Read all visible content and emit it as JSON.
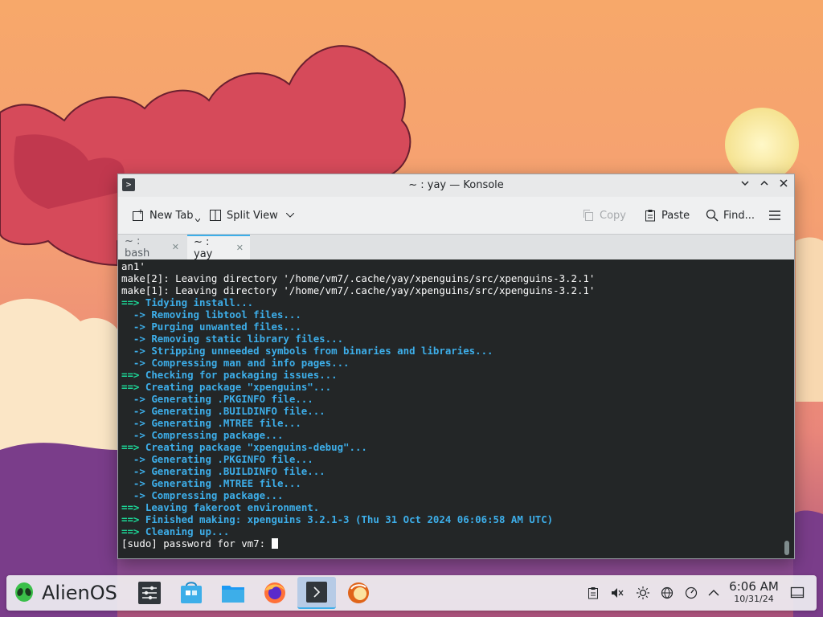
{
  "window": {
    "title": "~ : yay — Konsole"
  },
  "toolbar": {
    "new_tab": "New Tab",
    "split_view": "Split View",
    "copy": "Copy",
    "paste": "Paste",
    "find": "Find..."
  },
  "tabs": [
    {
      "label": "~ : bash",
      "active": false
    },
    {
      "label": "~ : yay",
      "active": true
    }
  ],
  "terminal": {
    "lines": [
      {
        "type": "plain",
        "text": "an1'"
      },
      {
        "type": "plain",
        "text": "make[2]: Leaving directory '/home/vm7/.cache/yay/xpenguins/src/xpenguins-3.2.1'"
      },
      {
        "type": "plain",
        "text": "make[1]: Leaving directory '/home/vm7/.cache/yay/xpenguins/src/xpenguins-3.2.1'"
      },
      {
        "type": "step",
        "prefix": "==>",
        "text": "Tidying install..."
      },
      {
        "type": "sub",
        "prefix": "  ->",
        "text": "Removing libtool files..."
      },
      {
        "type": "sub",
        "prefix": "  ->",
        "text": "Purging unwanted files..."
      },
      {
        "type": "sub",
        "prefix": "  ->",
        "text": "Removing static library files..."
      },
      {
        "type": "sub",
        "prefix": "  ->",
        "text": "Stripping unneeded symbols from binaries and libraries..."
      },
      {
        "type": "sub",
        "prefix": "  ->",
        "text": "Compressing man and info pages..."
      },
      {
        "type": "step",
        "prefix": "==>",
        "text": "Checking for packaging issues..."
      },
      {
        "type": "step",
        "prefix": "==>",
        "text": "Creating package \"xpenguins\"..."
      },
      {
        "type": "sub",
        "prefix": "  ->",
        "text": "Generating .PKGINFO file..."
      },
      {
        "type": "sub",
        "prefix": "  ->",
        "text": "Generating .BUILDINFO file..."
      },
      {
        "type": "sub",
        "prefix": "  ->",
        "text": "Generating .MTREE file..."
      },
      {
        "type": "sub",
        "prefix": "  ->",
        "text": "Compressing package..."
      },
      {
        "type": "step",
        "prefix": "==>",
        "text": "Creating package \"xpenguins-debug\"..."
      },
      {
        "type": "sub",
        "prefix": "  ->",
        "text": "Generating .PKGINFO file..."
      },
      {
        "type": "sub",
        "prefix": "  ->",
        "text": "Generating .BUILDINFO file..."
      },
      {
        "type": "sub",
        "prefix": "  ->",
        "text": "Generating .MTREE file..."
      },
      {
        "type": "sub",
        "prefix": "  ->",
        "text": "Compressing package..."
      },
      {
        "type": "step",
        "prefix": "==>",
        "text": "Leaving fakeroot environment."
      },
      {
        "type": "step",
        "prefix": "==>",
        "text": "Finished making: xpenguins 3.2.1-3 (Thu 31 Oct 2024 06:06:58 AM UTC)"
      },
      {
        "type": "step",
        "prefix": "==>",
        "text": "Cleaning up..."
      },
      {
        "type": "prompt",
        "text": "[sudo] password for vm7: "
      }
    ]
  },
  "taskbar": {
    "launcher_label": "AlienOS",
    "tasks": [
      {
        "name": "system-settings",
        "active": false
      },
      {
        "name": "discover",
        "active": false
      },
      {
        "name": "dolphin",
        "active": false
      },
      {
        "name": "firefox",
        "active": false
      },
      {
        "name": "konsole",
        "active": true
      },
      {
        "name": "alienos-app",
        "active": false
      }
    ],
    "tray_icons": [
      "clipboard-icon",
      "volume-muted-icon",
      "brightness-icon",
      "network-icon",
      "updates-icon",
      "expand-tray-icon"
    ],
    "clock_time": "6:06 AM",
    "clock_date": "10/31/24"
  },
  "colors": {
    "terminal_bg": "#232627",
    "arrow_green": "#1cdc9a",
    "text_blue": "#3daee9",
    "accent": "#3daee9"
  }
}
